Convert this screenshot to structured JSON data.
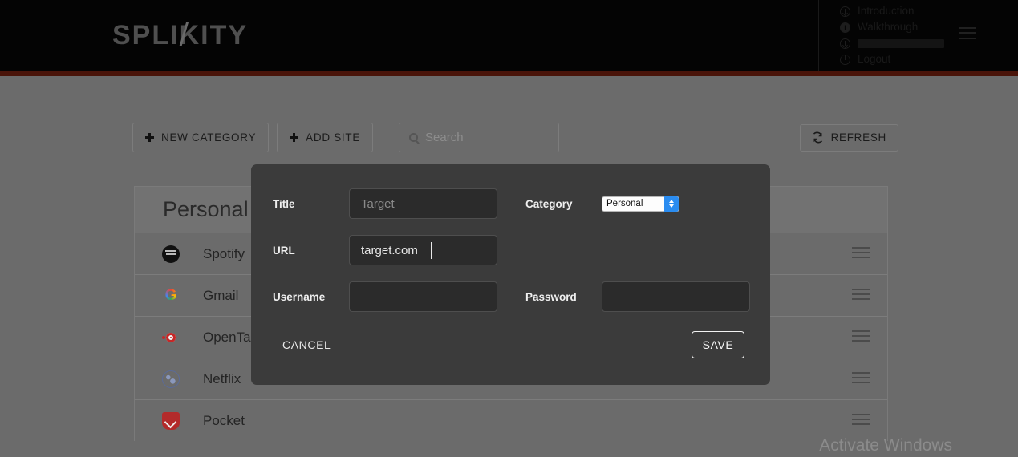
{
  "header": {
    "logo_text": "SPLIKITY",
    "menu": [
      {
        "label": "Introduction",
        "icon": "download-circle-icon"
      },
      {
        "label": "Walkthrough",
        "icon": "info-circle-icon"
      },
      {
        "label": "",
        "icon": "download-circle-icon",
        "redacted": true
      },
      {
        "label": "Logout",
        "icon": "power-icon"
      }
    ],
    "hamburger_icon": "hamburger-menu-icon",
    "accent_color": "#4a1409"
  },
  "toolbar": {
    "new_category_label": "NEW CATEGORY",
    "add_site_label": "ADD SITE",
    "search_placeholder": "Search",
    "search_value": "",
    "search_icon": "search-icon",
    "refresh_label": "REFRESH",
    "refresh_icon": "refresh-icon"
  },
  "category_card": {
    "title": "Personal",
    "rows": [
      {
        "name": "Spotify",
        "icon": "spotify-icon"
      },
      {
        "name": "Gmail",
        "icon": "google-icon"
      },
      {
        "name": "OpenTab",
        "icon": "opentab-icon"
      },
      {
        "name": "Netflix",
        "icon": "netflix-icon"
      },
      {
        "name": "Pocket",
        "icon": "pocket-icon"
      }
    ],
    "drag_handle_icon": "drag-handle-icon"
  },
  "modal": {
    "title_label": "Title",
    "title_value": "",
    "title_placeholder": "Target",
    "url_label": "URL",
    "url_value": "target.com",
    "username_label": "Username",
    "username_value": "",
    "password_label": "Password",
    "password_value": "",
    "category_label": "Category",
    "category_value": "Personal",
    "category_options": [
      "Personal"
    ],
    "cancel_label": "CANCEL",
    "save_label": "SAVE"
  },
  "watermark": {
    "text": "Activate Windows"
  }
}
